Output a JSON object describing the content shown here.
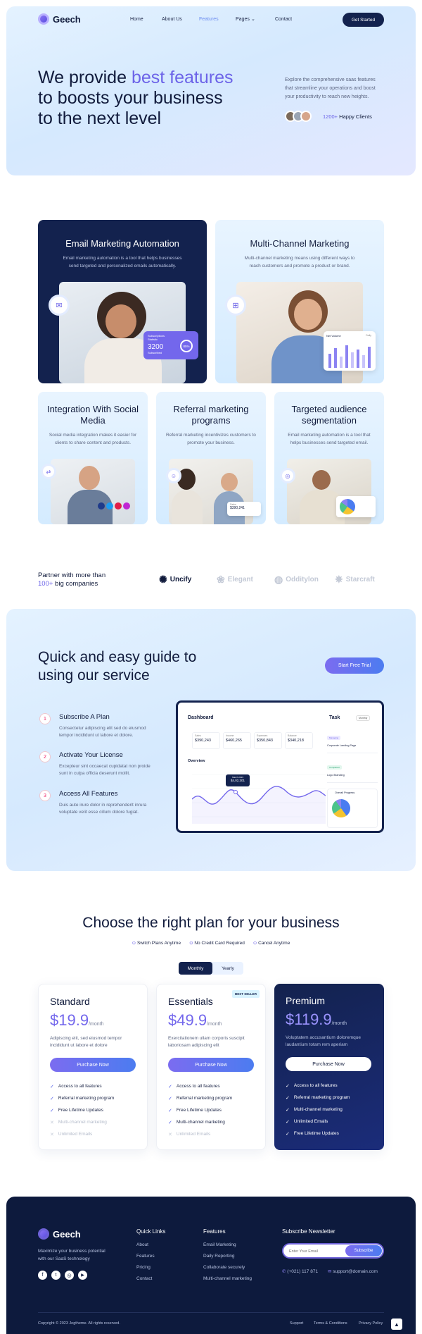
{
  "brand": {
    "name": "Geech"
  },
  "nav": {
    "home": "Home",
    "about": "About Us",
    "features": "Features",
    "pages": "Pages",
    "contact": "Contact",
    "cta": "Get Started"
  },
  "hero": {
    "title_a": "We provide ",
    "title_accent": "best features",
    "title_b": "to boosts your business",
    "title_c": "to the next level",
    "desc": "Explore the comprehensive saas features that streamline your operations and boost your productivity to reach new heights.",
    "clients_count": "1200+",
    "clients_label": " Happy Clients"
  },
  "features": [
    {
      "title": "Email Marketing Automation",
      "desc": "Email marketing automation is a tool that helps businesses send targeted and personalized emails automatically.",
      "stat_label": "Subscriptions Statistic",
      "stat_value": "3200",
      "stat_sub": "Subscribed",
      "stat_pct": "85%"
    },
    {
      "title": "Multi-Channel Marketing",
      "desc": "Multi-channel marketing means using different ways to reach customers and promote a product or brand.",
      "chart_title": "Net Volume",
      "chart_sub": "Daily"
    },
    {
      "title": "Integration With Social Media",
      "desc": "Social media integration makes it easier for clients to share content and products."
    },
    {
      "title": "Referral marketing programs",
      "desc": "Referral marketing incentivizes customers to promote your business.",
      "card_label": "Sales",
      "card_value": "$390,241"
    },
    {
      "title": "Targeted audience segmentation",
      "desc": "Email marketing automation is a tool that helps businesses send targeted email."
    }
  ],
  "partners": {
    "line1": "Partner with more than",
    "count": "100+",
    "line2": " big companies",
    "logos": [
      "Uncify",
      "Elegant",
      "Odditylon",
      "Starcraft"
    ]
  },
  "guide": {
    "title1": "Quick and easy guide to",
    "title2": "using our service",
    "cta": "Start Free Trial",
    "steps": [
      {
        "num": "1",
        "title": "Subscribe A Plan",
        "desc": "Consectetur adipiscing elit sed do eiusmod tempor incididunt ut labore et dolore."
      },
      {
        "num": "2",
        "title": "Activate Your License",
        "desc": "Excepteur sint occaecat cupidatat non proide sunt in culpa officia deserunt mollit."
      },
      {
        "num": "3",
        "title": "Access All Features",
        "desc": "Duis aute irure dolor in reprehenderit inrura voluptate velit esse cillum dolore fugiat."
      }
    ],
    "dashboard": {
      "title": "Dashboard",
      "task": "Task",
      "filter": "Monthly",
      "overview": "Overview",
      "tooltip_date": "March 2023",
      "tooltip_val": "$4,02,301",
      "stats": [
        {
          "label": "Sales",
          "value": "$390,243"
        },
        {
          "label": "Income",
          "value": "$460,265"
        },
        {
          "label": "Expenses",
          "value": "$350,843"
        },
        {
          "label": "Balance",
          "value": "$340,218"
        }
      ],
      "tasks": [
        {
          "tag": "Managing",
          "title": "Corporate Landing Page"
        },
        {
          "tag": "Completed",
          "title": "Logo Branding"
        },
        {
          "title": "Overall Progress"
        }
      ]
    }
  },
  "pricing": {
    "title": "Choose the right plan for your business",
    "perks": [
      "Switch Plans Anytime",
      "No Credit Card Required",
      "Cancel Anytime"
    ],
    "toggle": [
      "Monthly",
      "Yearly"
    ],
    "best_seller": "BEST SELLER",
    "plans": [
      {
        "name": "Standard",
        "price": "$19.9",
        "period": "/month",
        "desc": "Adipiscing elit, sed eiusmod tempor incididunt ut labore et dolore",
        "button": "Purchase Now",
        "features": [
          "Access to all features",
          "Referral marketing program",
          "Free Lifetime Updates",
          "Multi-channel marketing",
          "Unlimited Emails"
        ]
      },
      {
        "name": "Essentials",
        "price": "$49.9",
        "period": "/month",
        "desc": "Exercitationem ullam corporis suscipit laboriosam adipiscing elit",
        "button": "Purchase Now",
        "features": [
          "Access to all features",
          "Referral marketing program",
          "Free Lifetime Updates",
          "Multi-channel marketing",
          "Unlimited Emails"
        ]
      },
      {
        "name": "Premium",
        "price": "$119.9",
        "period": "/month",
        "desc": "Voluptatem accusantium doloremque laudantium totam rem aperiam",
        "button": "Purchase Now",
        "features": [
          "Access to all features",
          "Referral marketing program",
          "Multi-channel marketing",
          "Unlimited Emails",
          "Free Lifetime Updates"
        ]
      }
    ]
  },
  "footer": {
    "brand": "Geech",
    "about": "Maximize your business potential with our SaaS technology",
    "col1_title": "Quick Links",
    "col1": [
      "About",
      "Features",
      "Pricing",
      "Contact"
    ],
    "col2_title": "Features",
    "col2": [
      "Email Marketing",
      "Daily Reporting",
      "Collaborate securely",
      "Multi-channel marketing"
    ],
    "newsletter_title": "Subscribe Newsletter",
    "newsletter_placeholder": "Enter Your Email",
    "subscribe": "Subscribe",
    "phone": "(+021) 117 871",
    "email": "support@domain.com",
    "copyright": "Copyright © 2023 Jegtheme. All rights reserved.",
    "links": [
      "Support",
      "Terms & Conditions",
      "Privacy Policy"
    ]
  },
  "colors": {
    "accent": "#6c63e8",
    "navy": "#13224e",
    "footer": "#0d1a3d"
  }
}
